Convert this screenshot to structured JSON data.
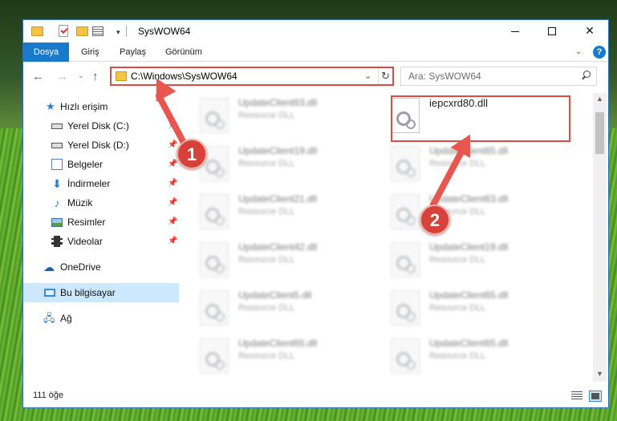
{
  "window": {
    "title": "SysWOW64",
    "quick_access_dropdown": "▾"
  },
  "ribbon": {
    "tabs": [
      {
        "label": "Dosya"
      },
      {
        "label": "Giriş"
      },
      {
        "label": "Paylaş"
      },
      {
        "label": "Görünüm"
      }
    ],
    "help": "?"
  },
  "navigation": {
    "address": "C:\\Windows\\SysWOW64",
    "search_placeholder": "Ara: SysWOW64"
  },
  "sidebar": {
    "items": [
      {
        "label": "Hızlı erişim",
        "icon": "star-icon"
      },
      {
        "label": "Yerel Disk (C:)",
        "icon": "drive-icon",
        "pinned": true
      },
      {
        "label": "Yerel Disk (D:)",
        "icon": "drive-icon",
        "pinned": true
      },
      {
        "label": "Belgeler",
        "icon": "documents-icon",
        "pinned": true
      },
      {
        "label": "İndirmeler",
        "icon": "downloads-icon",
        "pinned": true
      },
      {
        "label": "Müzik",
        "icon": "music-icon",
        "pinned": true
      },
      {
        "label": "Resimler",
        "icon": "pictures-icon",
        "pinned": true
      },
      {
        "label": "Videolar",
        "icon": "videos-icon",
        "pinned": true
      },
      {
        "label": "OneDrive",
        "icon": "onedrive-icon"
      },
      {
        "label": "Bu bilgisayar",
        "icon": "this-pc-icon",
        "selected": true
      },
      {
        "label": "Ağ",
        "icon": "network-icon"
      }
    ]
  },
  "files": {
    "left_column": [
      {
        "name": "UpdateClient63.dll",
        "type": "Resource DLL"
      },
      {
        "name": "UpdateClient19.dll",
        "type": "Resource DLL"
      },
      {
        "name": "UpdateClient21.dll",
        "type": "Resource DLL"
      },
      {
        "name": "UpdateClient42.dll",
        "type": "Resource DLL"
      },
      {
        "name": "UpdateClient5.dll",
        "type": "Resource DLL"
      },
      {
        "name": "UpdateClient65.dll",
        "type": "Resource DLL"
      }
    ],
    "right_column": [
      {
        "name": "iepcxrd80.dll",
        "type": ""
      },
      {
        "name": "UpdateClient65.dll",
        "type": "Resource DLL"
      },
      {
        "name": "UpdateClient63.dll",
        "type": "Resource DLL"
      },
      {
        "name": "UpdateClient19.dll",
        "type": "Resource DLL"
      },
      {
        "name": "UpdateClient65.dll",
        "type": "Resource DLL"
      },
      {
        "name": "UpdateClient65.dll",
        "type": "Resource DLL"
      }
    ]
  },
  "status": {
    "item_count": "111 öğe"
  },
  "annotations": {
    "step1": "1",
    "step2": "2",
    "color": "#e04a44"
  }
}
